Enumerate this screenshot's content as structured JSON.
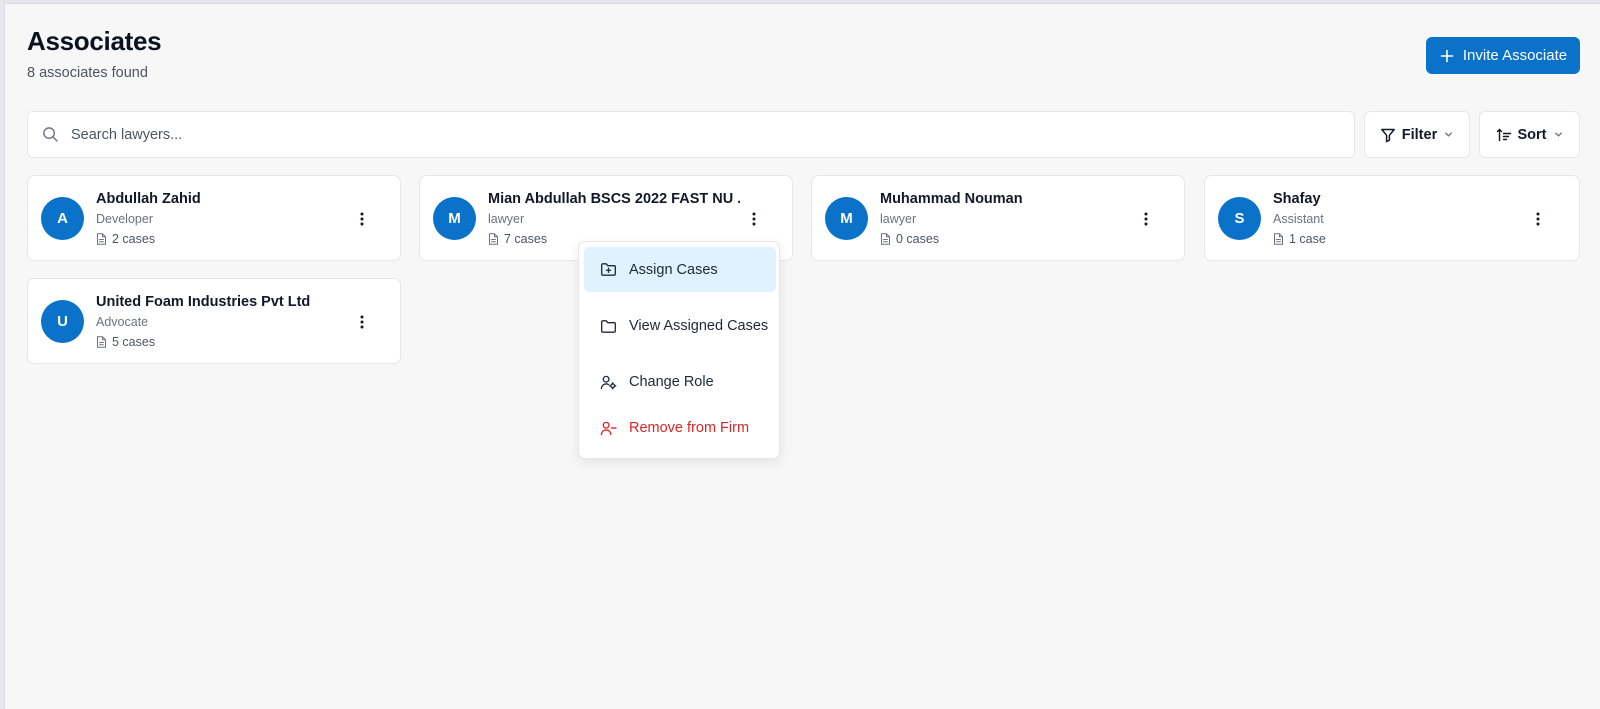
{
  "header": {
    "title": "Associates",
    "subtitle": "8 associates found",
    "invite_label": "Invite Associate"
  },
  "search": {
    "placeholder": "Search lawyers...",
    "value": ""
  },
  "toolbar": {
    "filter_label": "Filter",
    "sort_label": "Sort"
  },
  "associates": [
    {
      "initial": "A",
      "name": "Abdullah Zahid",
      "role": "Developer",
      "cases": "2 cases"
    },
    {
      "initial": "M",
      "name": "Mian Abdullah BSCS 2022 FAST NU ...",
      "role": "lawyer",
      "cases": "7 cases"
    },
    {
      "initial": "M",
      "name": "Muhammad Nouman",
      "role": "lawyer",
      "cases": "0 cases"
    },
    {
      "initial": "S",
      "name": "Shafay",
      "role": "Assistant",
      "cases": "1 case"
    },
    {
      "initial": "U",
      "name": "United Foam Industries Pvt Ltd",
      "role": "Advocate",
      "cases": "5 cases"
    }
  ],
  "context_menu": {
    "items": [
      {
        "label": "Assign Cases",
        "icon": "folder-plus-icon"
      },
      {
        "label": "View Assigned Cases",
        "icon": "folder-icon"
      },
      {
        "label": "Change Role",
        "icon": "user-cog-icon"
      },
      {
        "label": "Remove from Firm",
        "icon": "user-minus-icon"
      }
    ]
  },
  "colors": {
    "accent": "#0a72c8",
    "menu_highlight": "#e0f2fe",
    "danger": "#dc2626"
  }
}
